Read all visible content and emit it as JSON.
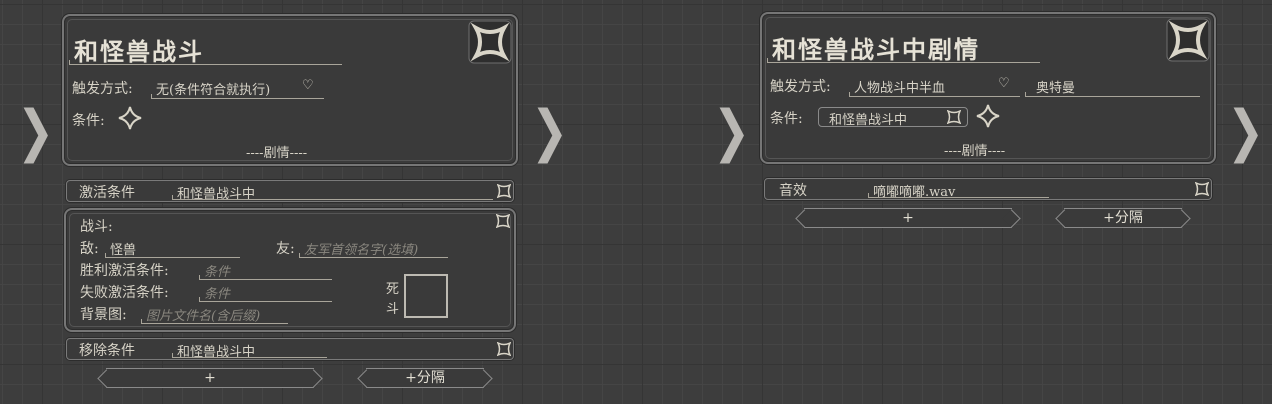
{
  "left": {
    "node": {
      "title": "和怪兽战斗",
      "trigger_label": "触发方式:",
      "trigger_value": "无(条件符合就执行)",
      "condition_label": "条件:",
      "story_label": "----剧情----"
    },
    "activate": {
      "label": "激活条件",
      "value": "和怪兽战斗中"
    },
    "battle": {
      "header": "战斗:",
      "enemy_label": "敌:",
      "enemy_value": "怪兽",
      "friend_label": "友:",
      "friend_placeholder": "友军首领名字(选填)",
      "win_label": "胜利激活条件:",
      "win_placeholder": "条件",
      "lose_label": "失败激活条件:",
      "lose_placeholder": "条件",
      "bg_label": "背景图:",
      "bg_placeholder": "图片文件名(含后缀)",
      "death_label_1": "死",
      "death_label_2": "斗"
    },
    "remove": {
      "label": "移除条件",
      "value": "和怪兽战斗中"
    },
    "add_label": "+",
    "separator_label": "+分隔"
  },
  "right": {
    "node": {
      "title": "和怪兽战斗中剧情",
      "trigger_label": "触发方式:",
      "trigger_value": "人物战斗中半血",
      "trigger_target": "奥特曼",
      "condition_label": "条件:",
      "condition_tag": "和怪兽战斗中",
      "story_label": "----剧情----"
    },
    "sound": {
      "label": "音效",
      "value": "嘀嘟嘀嘟.wav"
    },
    "add_label": "+",
    "separator_label": "+分隔"
  }
}
